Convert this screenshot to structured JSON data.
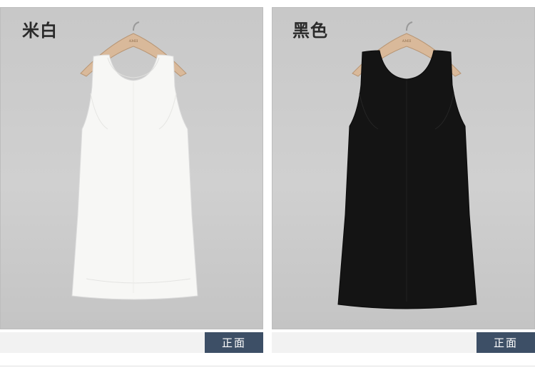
{
  "panels": [
    {
      "color_name": "米白",
      "view_label": "正面",
      "dress_color": "#f7f7f5",
      "hanger_brand": "AMII"
    },
    {
      "color_name": "黑色",
      "view_label": "正面",
      "dress_color": "#141414",
      "hanger_brand": "AMII"
    }
  ],
  "colors": {
    "background": "#c9c9c9",
    "hanger": "#d9b99a",
    "tag_background": "#3d4f66",
    "footer_bar": "#f2f2f2"
  }
}
